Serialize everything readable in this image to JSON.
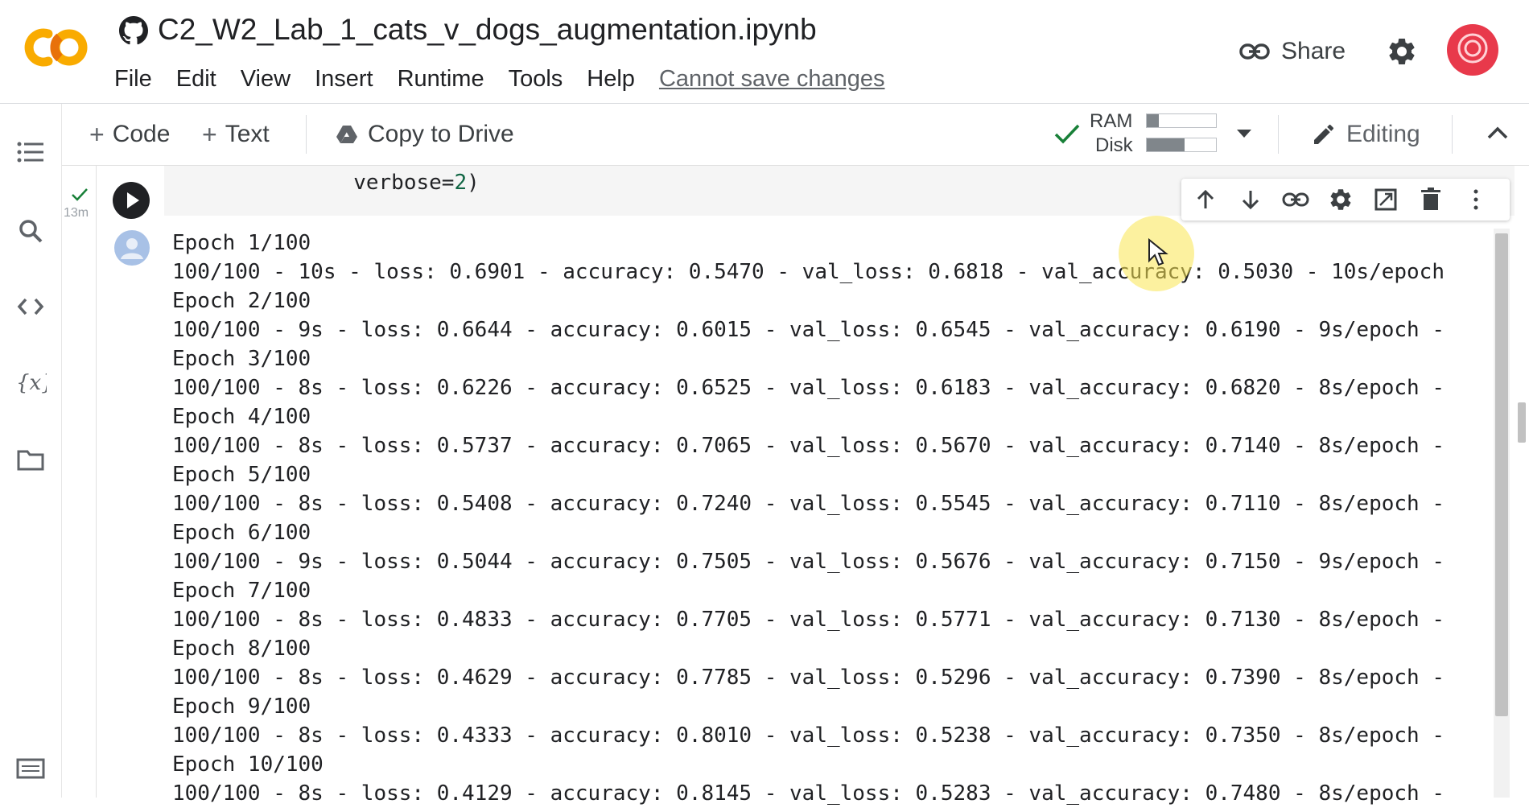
{
  "header": {
    "notebook_title": "C2_W2_Lab_1_cats_v_dogs_augmentation.ipynb",
    "menu": [
      "File",
      "Edit",
      "View",
      "Insert",
      "Runtime",
      "Tools",
      "Help"
    ],
    "save_status": "Cannot save changes",
    "share_label": "Share"
  },
  "toolbar": {
    "add_code": "Code",
    "add_text": "Text",
    "copy_to_drive": "Copy to Drive",
    "ram_label": "RAM",
    "disk_label": "Disk",
    "ram_usage": 0.18,
    "disk_usage": 0.55,
    "editing_label": "Editing"
  },
  "cell": {
    "exec_time": "13m",
    "code_prefix": "        verbose=",
    "code_number": "2",
    "code_suffix": ")",
    "output": [
      "Epoch 1/100",
      "100/100 - 10s - loss: 0.6901 - accuracy: 0.5470 - val_loss: 0.6818 - val_accuracy: 0.5030 - 10s/epoch",
      "Epoch 2/100",
      "100/100 - 9s - loss: 0.6644 - accuracy: 0.6015 - val_loss: 0.6545 - val_accuracy: 0.6190 - 9s/epoch -",
      "Epoch 3/100",
      "100/100 - 8s - loss: 0.6226 - accuracy: 0.6525 - val_loss: 0.6183 - val_accuracy: 0.6820 - 8s/epoch -",
      "Epoch 4/100",
      "100/100 - 8s - loss: 0.5737 - accuracy: 0.7065 - val_loss: 0.5670 - val_accuracy: 0.7140 - 8s/epoch -",
      "Epoch 5/100",
      "100/100 - 8s - loss: 0.5408 - accuracy: 0.7240 - val_loss: 0.5545 - val_accuracy: 0.7110 - 8s/epoch -",
      "Epoch 6/100",
      "100/100 - 9s - loss: 0.5044 - accuracy: 0.7505 - val_loss: 0.5676 - val_accuracy: 0.7150 - 9s/epoch -",
      "Epoch 7/100",
      "100/100 - 8s - loss: 0.4833 - accuracy: 0.7705 - val_loss: 0.5771 - val_accuracy: 0.7130 - 8s/epoch -",
      "Epoch 8/100",
      "100/100 - 8s - loss: 0.4629 - accuracy: 0.7785 - val_loss: 0.5296 - val_accuracy: 0.7390 - 8s/epoch -",
      "Epoch 9/100",
      "100/100 - 8s - loss: 0.4333 - accuracy: 0.8010 - val_loss: 0.5238 - val_accuracy: 0.7350 - 8s/epoch -",
      "Epoch 10/100",
      "100/100 - 8s - loss: 0.4129 - accuracy: 0.8145 - val_loss: 0.5283 - val_accuracy: 0.7480 - 8s/epoch -"
    ]
  },
  "colors": {
    "logo_orange": "#f9ab00",
    "logo_dark_orange": "#e8710a",
    "check_green": "#188038",
    "avatar_red": "#e8394b"
  },
  "icons": {
    "left_rail": [
      "table-of-contents-icon",
      "search-icon",
      "code-snippets-icon",
      "variables-icon",
      "files-icon",
      "terminal-icon"
    ],
    "cell_toolbar": [
      "move-up-icon",
      "move-down-icon",
      "link-icon",
      "settings-icon",
      "mirror-cell-icon",
      "delete-icon",
      "more-icon"
    ]
  }
}
